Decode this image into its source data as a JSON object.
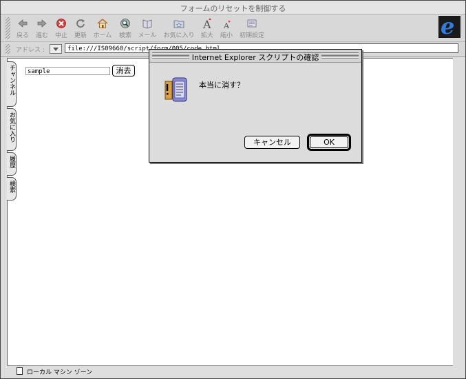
{
  "window": {
    "title": "フォームのリセットを制御する"
  },
  "toolbar": {
    "buttons": [
      {
        "label": "戻る",
        "icon": "back-arrow-icon"
      },
      {
        "label": "進む",
        "icon": "forward-arrow-icon"
      },
      {
        "label": "中止",
        "icon": "stop-icon"
      },
      {
        "label": "更新",
        "icon": "refresh-icon"
      },
      {
        "label": "ホーム",
        "icon": "home-icon"
      },
      {
        "label": "検索",
        "icon": "search-icon"
      },
      {
        "label": "メール",
        "icon": "mail-icon"
      },
      {
        "label": "お気に入り",
        "icon": "favorites-icon"
      },
      {
        "label": "拡大",
        "icon": "text-larger-icon"
      },
      {
        "label": "縮小",
        "icon": "text-smaller-icon"
      },
      {
        "label": "初期設定",
        "icon": "preferences-icon"
      }
    ]
  },
  "address": {
    "label": "アドレス :",
    "url": "file:///IS09660/script/form/005/code.html"
  },
  "sidebar": {
    "tabs": [
      {
        "label": "チャンネル"
      },
      {
        "label": "お気に入り"
      },
      {
        "label": "履歴"
      },
      {
        "label": "検索"
      }
    ]
  },
  "page": {
    "input_value": "sample",
    "button_label": "消去"
  },
  "dialog": {
    "title": "Internet Explorer スクリプトの確認",
    "message": "本当に消す？",
    "cancel_label": "キャンセル",
    "ok_label": "OK"
  },
  "status": {
    "text": "ローカル マシン ゾーン"
  },
  "colors": {
    "ie_logo": "#2f7de0",
    "stop_icon": "#d84040",
    "dialog_bg": "#dcdcdc"
  }
}
